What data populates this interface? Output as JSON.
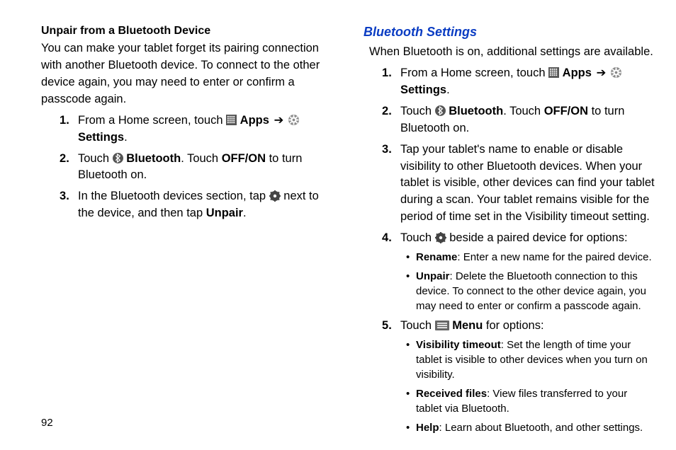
{
  "pageNumber": "92",
  "left": {
    "heading": "Unpair from a Bluetooth Device",
    "intro": "You can make your tablet forget its pairing connection with another Bluetooth device. To connect to the other device again, you may need to enter or confirm a passcode again.",
    "step1_a": "From a Home screen, touch ",
    "step1_apps": "Apps",
    "step1_settings": "Settings",
    "step2_a": "Touch ",
    "step2_bt": "Bluetooth",
    "step2_b": ". Touch ",
    "step2_offon": "OFF/ON",
    "step2_c": " to turn Bluetooth on.",
    "step3_a": "In the Bluetooth devices section, tap ",
    "step3_b": " next to the device, and then tap ",
    "step3_unpair": "Unpair",
    "step3_c": "."
  },
  "right": {
    "heading": "Bluetooth Settings",
    "intro": "When Bluetooth is on, additional settings are available.",
    "step1_a": "From a Home screen, touch ",
    "step1_apps": "Apps",
    "step1_settings": "Settings",
    "step2_a": "Touch ",
    "step2_bt": "Bluetooth",
    "step2_b": ". Touch ",
    "step2_offon": "OFF/ON",
    "step2_c": " to turn Bluetooth on.",
    "step3": "Tap your tablet's name to enable or disable visibility to other Bluetooth devices. When your tablet is visible, other devices can find your tablet during a scan. Your tablet remains visible for the period of time set in the Visibility timeout setting.",
    "step4_a": "Touch ",
    "step4_b": " beside a paired device for options:",
    "step4_bul1_b": "Rename",
    "step4_bul1_t": ": Enter a new name for the paired device.",
    "step4_bul2_b": "Unpair",
    "step4_bul2_t": ": Delete the Bluetooth connection to this device. To connect to the other device again, you may need to enter or confirm a passcode again.",
    "step5_a": "Touch ",
    "step5_menu": "Menu",
    "step5_b": " for options:",
    "step5_bul1_b": "Visibility timeout",
    "step5_bul1_t": ": Set the length of time your tablet is visible to other devices when you turn on visibility.",
    "step5_bul2_b": "Received files",
    "step5_bul2_t": ": View files transferred to your tablet via Bluetooth.",
    "step5_bul3_b": "Help",
    "step5_bul3_t": ": Learn about Bluetooth, and other settings."
  }
}
